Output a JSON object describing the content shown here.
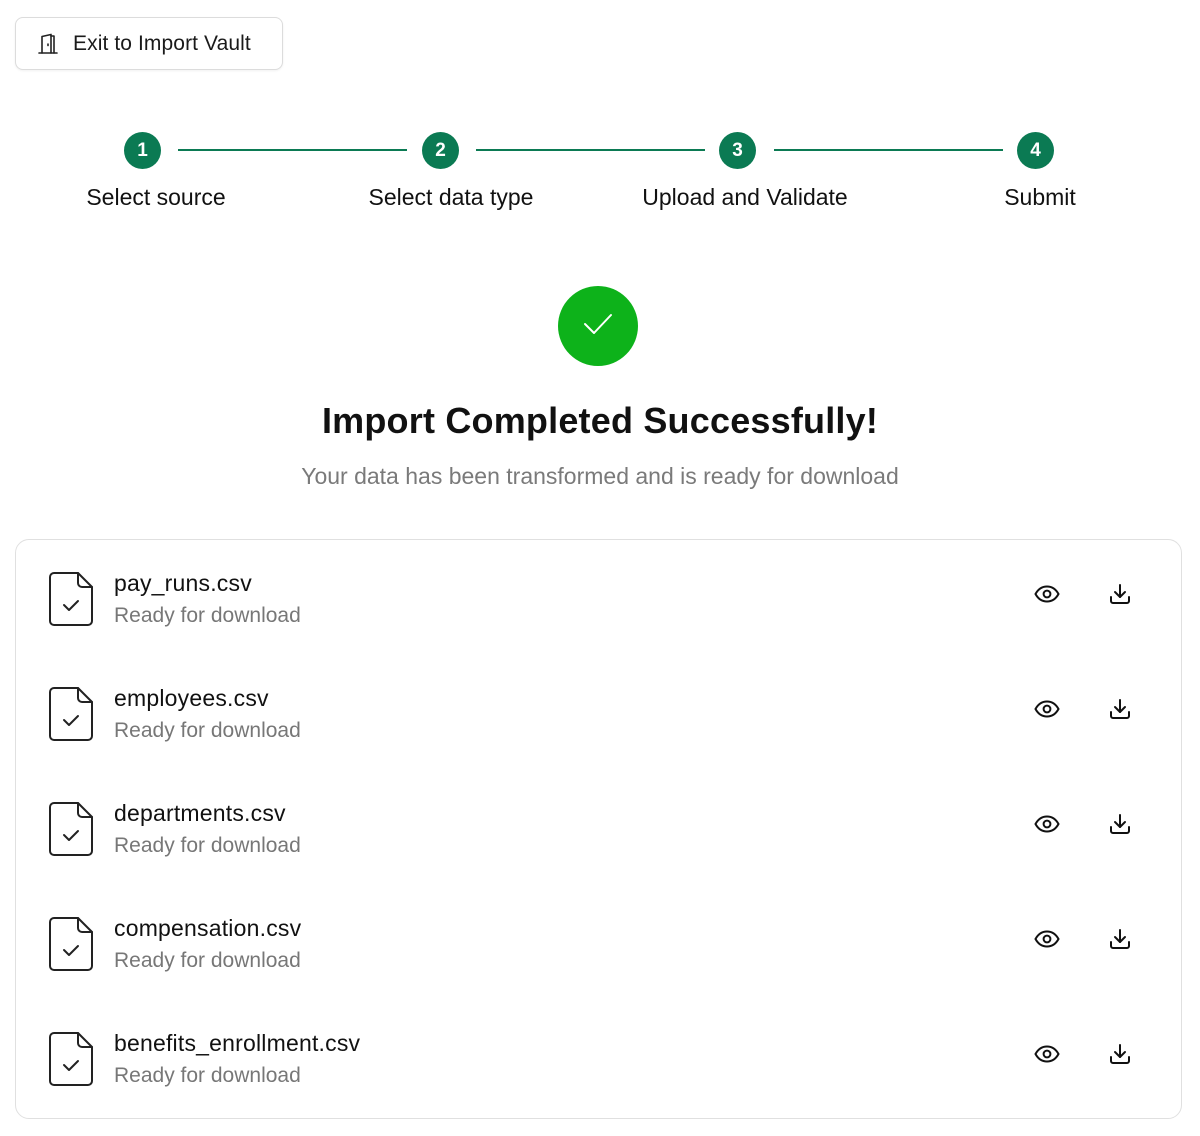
{
  "header": {
    "exit_button_label": "Exit to Import Vault",
    "exit_icon": "door-exit-icon"
  },
  "stepper": {
    "steps": [
      {
        "number": "1",
        "label": "Select source"
      },
      {
        "number": "2",
        "label": "Select data type"
      },
      {
        "number": "3",
        "label": "Upload and Validate"
      },
      {
        "number": "4",
        "label": "Submit"
      }
    ]
  },
  "result": {
    "icon": "check-icon",
    "title": "Import Completed Successfully!",
    "subtitle": "Your data has been transformed and is ready for download"
  },
  "files": [
    {
      "name": "pay_runs.csv",
      "status": "Ready for download"
    },
    {
      "name": "employees.csv",
      "status": "Ready for download"
    },
    {
      "name": "departments.csv",
      "status": "Ready for download"
    },
    {
      "name": "compensation.csv",
      "status": "Ready for download"
    },
    {
      "name": "benefits_enrollment.csv",
      "status": "Ready for download"
    }
  ],
  "colors": {
    "step_accent": "#0b7a53",
    "success": "#0db21a",
    "muted_text": "#777777",
    "border": "#e0e0e0"
  }
}
